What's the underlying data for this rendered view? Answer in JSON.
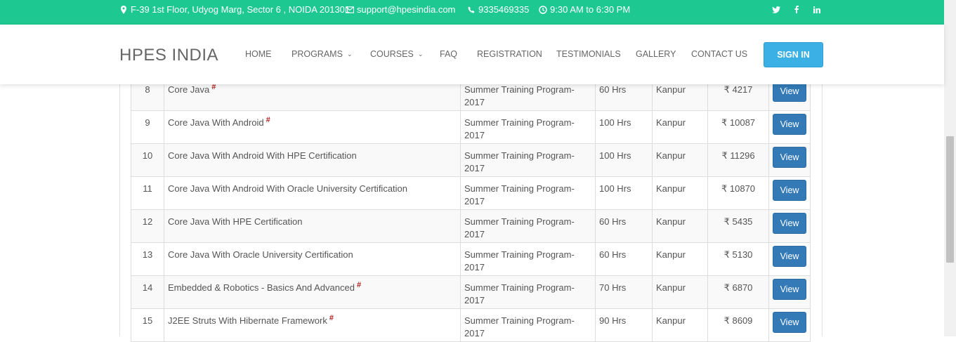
{
  "topbar": {
    "address": "F-39 1st Floor, Udyog Marg, Sector 6 , NOIDA 201301",
    "email": "support@hpesindia.com",
    "phone": "9335469335",
    "hours": "9:30 AM to 6:30 PM",
    "social": [
      "twitter-icon",
      "facebook-icon",
      "linkedin-icon"
    ],
    "bg_color": "#1ec891"
  },
  "header": {
    "logo": "HPES INDIA",
    "nav": [
      "HOME",
      "PROGRAMS",
      "COURSES",
      "FAQ",
      "REGISTRATION",
      "TESTIMONIALS",
      "GALLERY",
      "CONTACT US"
    ],
    "signin_label": "SIGN IN",
    "signin_color": "#3ab0e4"
  },
  "table": {
    "rows": [
      {
        "num": "8",
        "name": "Core Java",
        "program": "Summer Training Program-2017",
        "duration": "60 Hrs",
        "location": "Kanpur",
        "price": "4217",
        "action": "View"
      },
      {
        "num": "9",
        "name": "Core Java With Android",
        "program": "Summer Training Program-2017",
        "duration": "100 Hrs",
        "location": "Kanpur",
        "price": "10087",
        "action": "View"
      },
      {
        "num": "10",
        "name": "Core Java With Android With HPE Certification",
        "program": "Summer Training Program-2017",
        "duration": "100 Hrs",
        "location": "Kanpur",
        "price": "11296",
        "action": "View"
      },
      {
        "num": "11",
        "name": "Core Java With Android With Oracle University Certification",
        "program": "Summer Training Program-2017",
        "duration": "100 Hrs",
        "location": "Kanpur",
        "price": "10870",
        "action": "View"
      },
      {
        "num": "12",
        "name": "Core Java With HPE Certification",
        "program": "Summer Training Program-2017",
        "duration": "60 Hrs",
        "location": "Kanpur",
        "price": "5435",
        "action": "View"
      },
      {
        "num": "13",
        "name": "Core Java With Oracle University Certification",
        "program": "Summer Training Program-2017",
        "duration": "60 Hrs",
        "location": "Kanpur",
        "price": "5130",
        "action": "View"
      },
      {
        "num": "14",
        "name": "Embedded & Robotics - Basics And Advanced",
        "program": "Summer Training Program-2017",
        "duration": "70 Hrs",
        "location": "Kanpur",
        "price": "6870",
        "action": "View"
      },
      {
        "num": "15",
        "name": "J2EE Struts With Hibernate Framework",
        "program": "Summer Training Program-2017",
        "duration": "90 Hrs",
        "location": "Kanpur",
        "price": "8609",
        "action": "View"
      }
    ],
    "hash_mark": "#",
    "currency": "₹",
    "view_button_color": "#337ab7"
  }
}
